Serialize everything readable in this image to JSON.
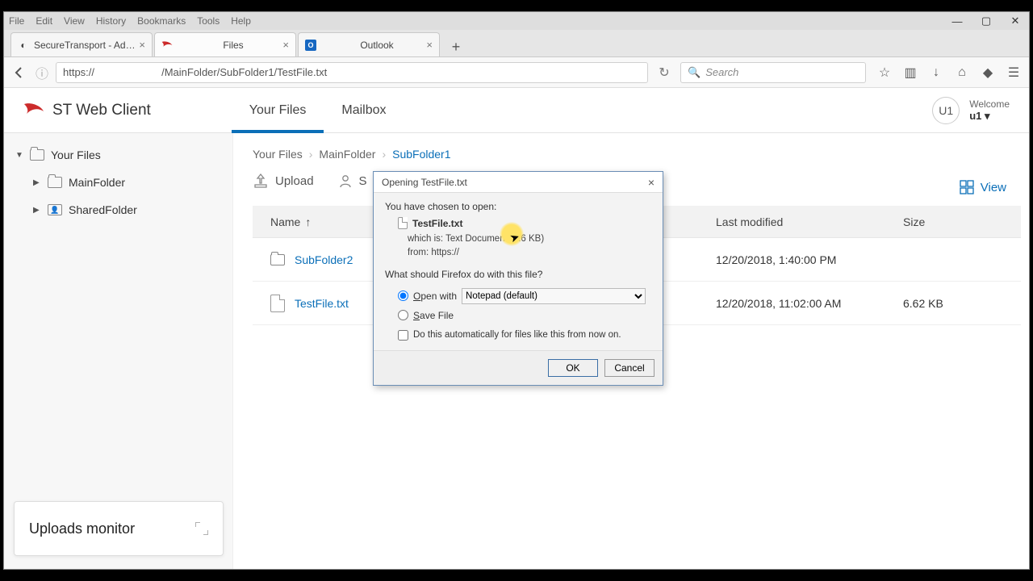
{
  "os_menu": [
    "File",
    "Edit",
    "View",
    "History",
    "Bookmarks",
    "Tools",
    "Help"
  ],
  "tabs": [
    {
      "label": "SecureTransport - Administrati"
    },
    {
      "label": "Files"
    },
    {
      "label": "Outlook"
    }
  ],
  "url": "https://                       /MainFolder/SubFolder1/TestFile.txt",
  "search_placeholder": "Search",
  "brand": "ST Web Client",
  "nav": {
    "files": "Your Files",
    "mailbox": "Mailbox"
  },
  "user": {
    "welcome": "Welcome",
    "name": "u1",
    "avatar": "U1"
  },
  "tree": {
    "root": "Your Files",
    "items": [
      {
        "label": "MainFolder",
        "type": "folder"
      },
      {
        "label": "SharedFolder",
        "type": "shared"
      }
    ]
  },
  "breadcrumb": [
    "Your Files",
    "MainFolder",
    "SubFolder1"
  ],
  "toolbar": {
    "upload": "Upload",
    "share": "S",
    "view": "View"
  },
  "columns": {
    "name": "Name",
    "modified": "Last modified",
    "size": "Size"
  },
  "rows": [
    {
      "icon": "folder",
      "name": "SubFolder2",
      "modified": "12/20/2018, 1:40:00 PM",
      "size": ""
    },
    {
      "icon": "file",
      "name": "TestFile.txt",
      "modified": "12/20/2018, 11:02:00 AM",
      "size": "6.62 KB"
    }
  ],
  "uploads_monitor": "Uploads monitor",
  "dialog": {
    "title": "Opening TestFile.txt",
    "chosen": "You have chosen to open:",
    "filename": "TestFile.txt",
    "which_is": "which is: Text Document (6.6 KB)",
    "from": "from: https://",
    "question": "What should Firefox do with this file?",
    "open_with": "Open with",
    "open_app": "Notepad (default)",
    "save": "Save File",
    "remember": "Do this automatically for files like this from now on.",
    "ok": "OK",
    "cancel": "Cancel"
  }
}
